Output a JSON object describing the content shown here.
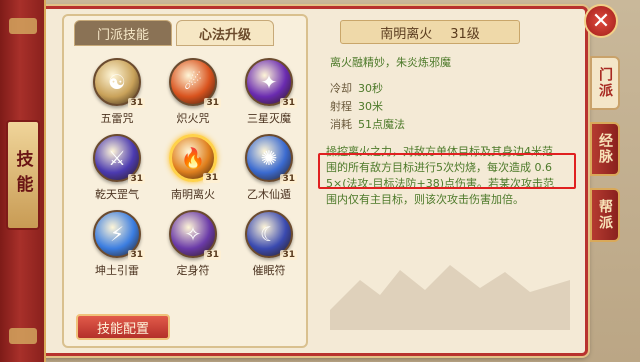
{
  "side_label": "技能",
  "tabs": [
    {
      "label": "门派技能",
      "active": false
    },
    {
      "label": "心法升级",
      "active": true
    }
  ],
  "skills": [
    {
      "name": "五雷咒",
      "level": "31",
      "icon": "thunder-ring-icon",
      "color": "#c9a25a"
    },
    {
      "name": "炽火咒",
      "level": "31",
      "icon": "fireball-icon",
      "color": "#d9531e"
    },
    {
      "name": "三星灭魔",
      "level": "31",
      "icon": "star-burst-icon",
      "color": "#6a2bb0"
    },
    {
      "name": "乾天罡气",
      "level": "31",
      "icon": "violet-blade-icon",
      "color": "#4b3ab0"
    },
    {
      "name": "南明离火",
      "level": "31",
      "icon": "flame-icon",
      "color": "#e0801e",
      "selected": true
    },
    {
      "name": "乙木仙遁",
      "level": "31",
      "icon": "vortex-icon",
      "color": "#3a6ad0"
    },
    {
      "name": "坤土引雷",
      "level": "31",
      "icon": "lightning-icon",
      "color": "#3b7de0"
    },
    {
      "name": "定身符",
      "level": "31",
      "icon": "talisman-icon",
      "color": "#6a3aa8"
    },
    {
      "name": "催眠符",
      "level": "31",
      "icon": "sleep-scroll-icon",
      "color": "#3a4ab0"
    }
  ],
  "config_button": "技能配置",
  "detail": {
    "name": "南明离火",
    "level": "31级",
    "subtitle": "离火融精妙，朱炎炼邪魔",
    "stats": [
      {
        "key": "冷却",
        "value": "30秒"
      },
      {
        "key": "射程",
        "value": "30米"
      },
      {
        "key": "消耗",
        "value": "51点魔法"
      }
    ],
    "description_lines": [
      "操控离火之力，对敌方单体目标及其身边4米范",
      "围的所有敌方目标进行5次灼烧，每次造成 0.6",
      "5×(法攻-目标法防+38)点伤害。若某次攻击范",
      "围内仅有主目标，则该次攻击伤害加倍。"
    ]
  },
  "side_tabs": [
    {
      "label": "门派",
      "active": true
    },
    {
      "label": "经脉",
      "active": false
    },
    {
      "label": "帮派",
      "active": false
    }
  ],
  "close_icon": "close-icon"
}
